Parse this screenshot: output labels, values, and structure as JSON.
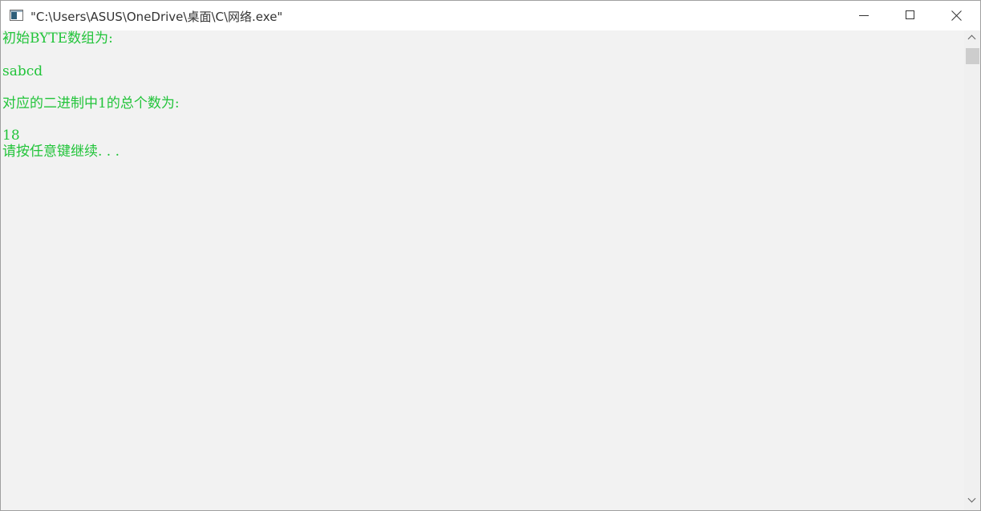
{
  "window": {
    "title": "\"C:\\Users\\ASUS\\OneDrive\\桌面\\C\\网络.exe\"",
    "icon": "console-window-icon",
    "controls": {
      "minimize_icon": "minimize-icon",
      "maximize_icon": "maximize-icon",
      "close_icon": "close-icon"
    }
  },
  "console": {
    "text_color": "#22c43a",
    "background_color": "#f2f2f2",
    "lines": [
      "初始BYTE数组为:",
      "sabcd",
      "对应的二进制中1的总个数为:",
      "18",
      "请按任意键继续. . ."
    ]
  },
  "scrollbar": {
    "up_icon": "chevron-up-icon",
    "down_icon": "chevron-down-icon"
  }
}
